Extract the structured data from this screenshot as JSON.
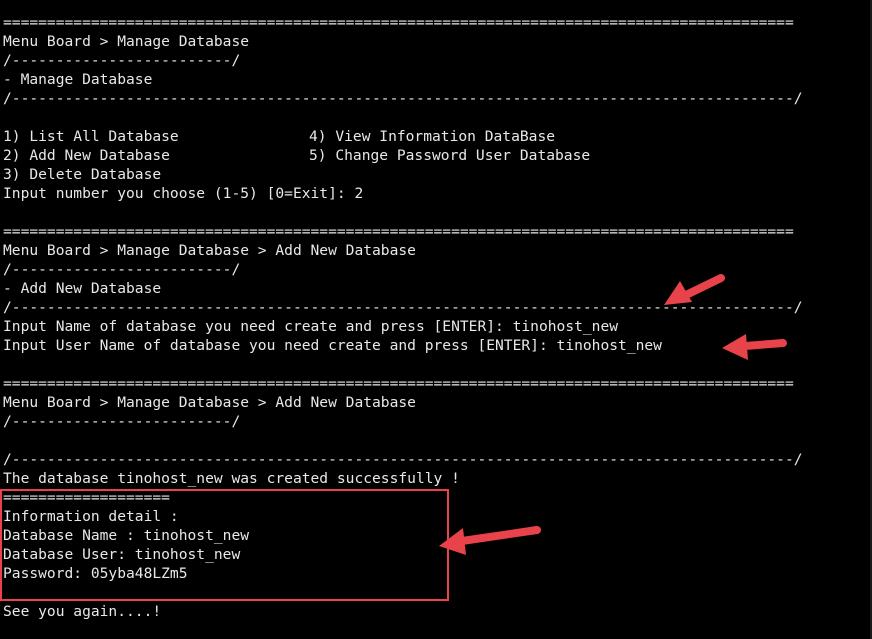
{
  "terminal": {
    "section1": {
      "rule": "==========================================================================================",
      "breadcrumb": "Menu Board > Manage Database",
      "sub_rule": "/-------------------------/",
      "heading": "- Manage Database",
      "long_rule": "/-----------------------------------------------------------------------------------------/",
      "menu": {
        "opt1": "1) List All Database",
        "opt2": "2) Add New Database",
        "opt3": "3) Delete Database",
        "opt4": "4) View Information DataBase",
        "opt5": "5) Change Password User Database"
      },
      "prompt": "Input number you choose (1-5) [0=Exit]: 2"
    },
    "section2": {
      "rule": "==========================================================================================",
      "breadcrumb": "Menu Board > Manage Database > Add New Database",
      "sub_rule": "/-------------------------/",
      "heading": "- Add New Database",
      "long_rule": "/-----------------------------------------------------------------------------------------/",
      "input_db_name": "Input Name of database you need create and press [ENTER]: tinohost_new",
      "input_user_name": "Input User Name of database you need create and press [ENTER]: tinohost_new"
    },
    "section3": {
      "rule": "==========================================================================================",
      "breadcrumb": "Menu Board > Manage Database > Add New Database",
      "sub_rule": "/-------------------------/",
      "long_rule": "/-----------------------------------------------------------------------------------------/",
      "success": "The database tinohost_new was created successfully !",
      "detail_rule": "===================",
      "detail_heading": "Information detail :",
      "db_name": "Database Name : tinohost_new",
      "db_user": "Database User: tinohost_new",
      "password": "Password: 05yba48LZm5",
      "goodbye": "See you again....!"
    }
  },
  "colors": {
    "background": "#000000",
    "text": "#e8e8e8",
    "annotation": "#e8424a"
  },
  "annotations": {
    "arrows": [
      "arrow-icon",
      "arrow-icon",
      "arrow-icon"
    ],
    "box": "highlight-box"
  }
}
